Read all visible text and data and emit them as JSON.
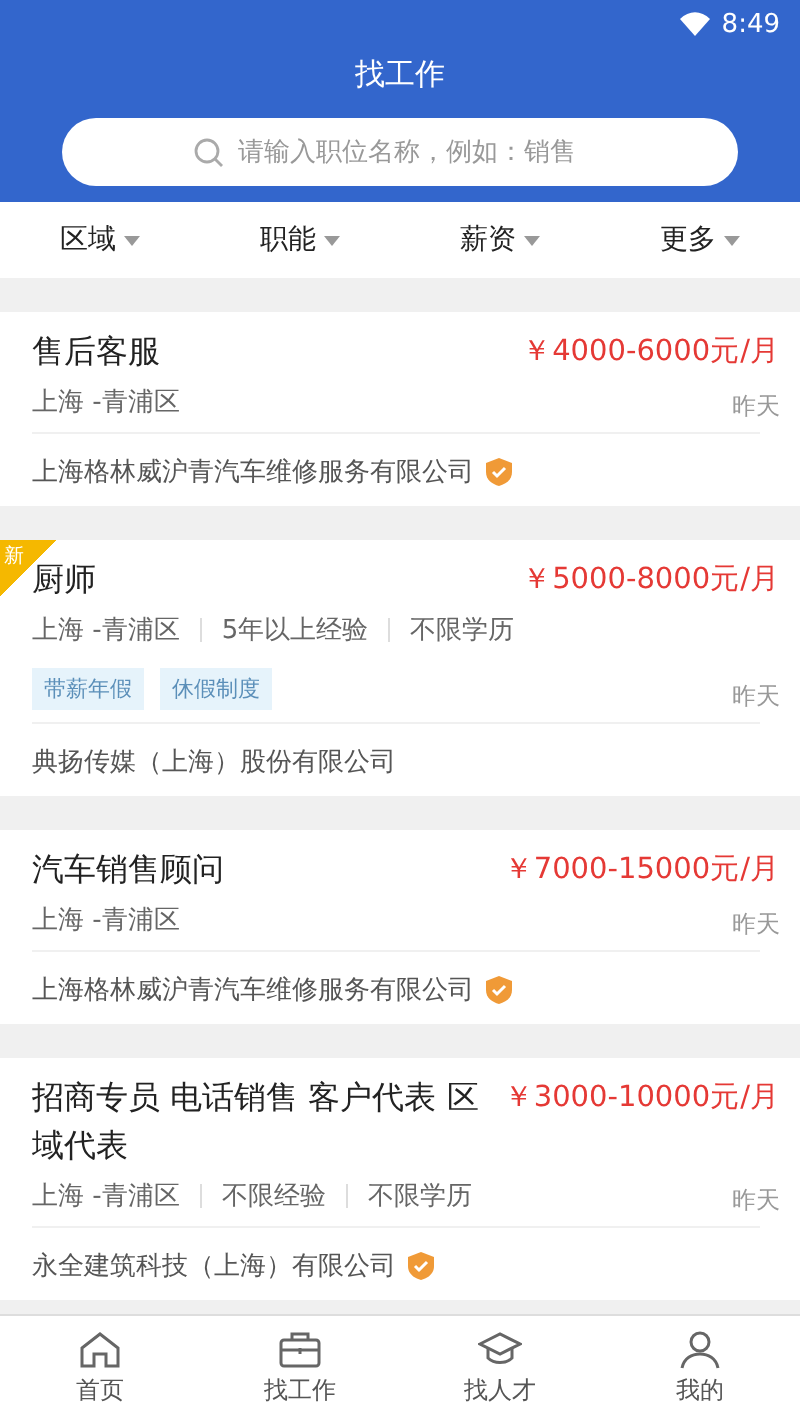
{
  "status_bar": {
    "time": "8:49"
  },
  "header": {
    "title": "找工作",
    "search": {
      "placeholder": "请输入职位名称，例如：销售"
    }
  },
  "filters": [
    "区域",
    "职能",
    "薪资",
    "更多"
  ],
  "jobs": [
    {
      "title": "售后客服",
      "salary": "￥4000-6000元/月",
      "is_new": false,
      "meta": [
        "上海 -青浦区"
      ],
      "time": "昨天",
      "company": "上海格林威沪青汽车维修服务有限公司",
      "verified": true
    },
    {
      "title": "厨师",
      "salary": "￥5000-8000元/月",
      "is_new": true,
      "badge": "新",
      "meta": [
        "上海 -青浦区",
        "5年以上经验",
        "不限学历"
      ],
      "tags": [
        "带薪年假",
        "休假制度"
      ],
      "time": "昨天",
      "company": "典扬传媒（上海）股份有限公司",
      "verified": false
    },
    {
      "title": "汽车销售顾问",
      "salary": "￥7000-15000元/月",
      "is_new": false,
      "meta": [
        "上海 -青浦区"
      ],
      "time": "昨天",
      "company": "上海格林威沪青汽车维修服务有限公司",
      "verified": true
    },
    {
      "title": "招商专员 电话销售 客户代表 区域代表",
      "salary": "￥3000-10000元/月",
      "is_new": false,
      "meta": [
        "上海 -青浦区",
        "不限经验",
        "不限学历"
      ],
      "time": "昨天",
      "company": "永全建筑科技（上海）有限公司",
      "verified": true
    }
  ],
  "tab_bar": [
    {
      "label": "首页",
      "kind": "home"
    },
    {
      "label": "找工作",
      "kind": "briefcase"
    },
    {
      "label": "找人才",
      "kind": "cap"
    },
    {
      "label": "我的",
      "kind": "person"
    }
  ]
}
